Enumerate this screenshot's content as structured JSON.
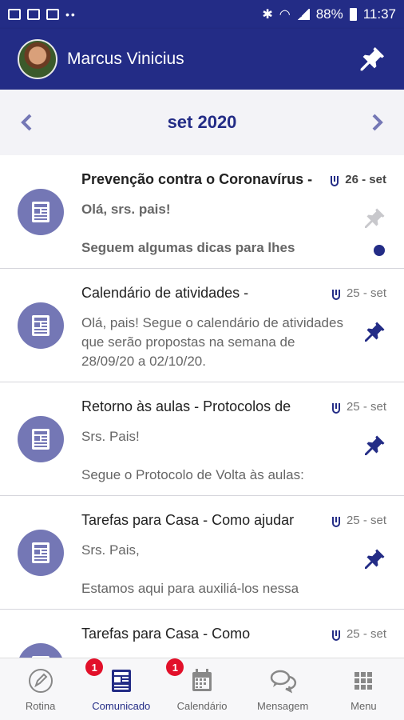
{
  "status_bar": {
    "battery": "88%",
    "time": "11:37"
  },
  "user": {
    "name": "Marcus Vinicius"
  },
  "month": {
    "label": "set 2020"
  },
  "messages": [
    {
      "title": "Prevenção contra o Coronavírus -",
      "date": "26 - set",
      "body": [
        "Olá, srs. pais!",
        "",
        "Seguem algumas dicas para lhes"
      ],
      "unread": true
    },
    {
      "title": "Calendário de atividades -",
      "date": "25 - set",
      "body": [
        "Olá, pais!  Segue o calendário de atividades que serão propostas na semana de 28/09/20 a 02/10/20."
      ],
      "unread": false
    },
    {
      "title": "Retorno às aulas - Protocolos de",
      "date": "25 - set",
      "body": [
        "Srs. Pais!",
        "",
        "Segue o Protocolo de Volta às aulas:"
      ],
      "unread": false
    },
    {
      "title": "Tarefas para Casa - Como ajudar",
      "date": "25 - set",
      "body": [
        "Srs. Pais,",
        "",
        "Estamos aqui para auxiliá-los nessa"
      ],
      "unread": false
    },
    {
      "title": "Tarefas para Casa - Como",
      "date": "25 - set",
      "body": [
        ""
      ],
      "unread": false
    }
  ],
  "nav": [
    {
      "label": "Rotina",
      "icon": "pencil-circle-icon",
      "badge": ""
    },
    {
      "label": "Comunicado",
      "icon": "newspaper-icon",
      "badge": "1",
      "active": true
    },
    {
      "label": "Calendário",
      "icon": "calendar-icon",
      "badge": "1"
    },
    {
      "label": "Mensagem",
      "icon": "chat-bubbles-icon",
      "badge": ""
    },
    {
      "label": "Menu",
      "icon": "grid-icon",
      "badge": ""
    }
  ],
  "colors": {
    "primary": "#232c86",
    "icon_circle": "#7477b5",
    "badge": "#e2102a"
  }
}
